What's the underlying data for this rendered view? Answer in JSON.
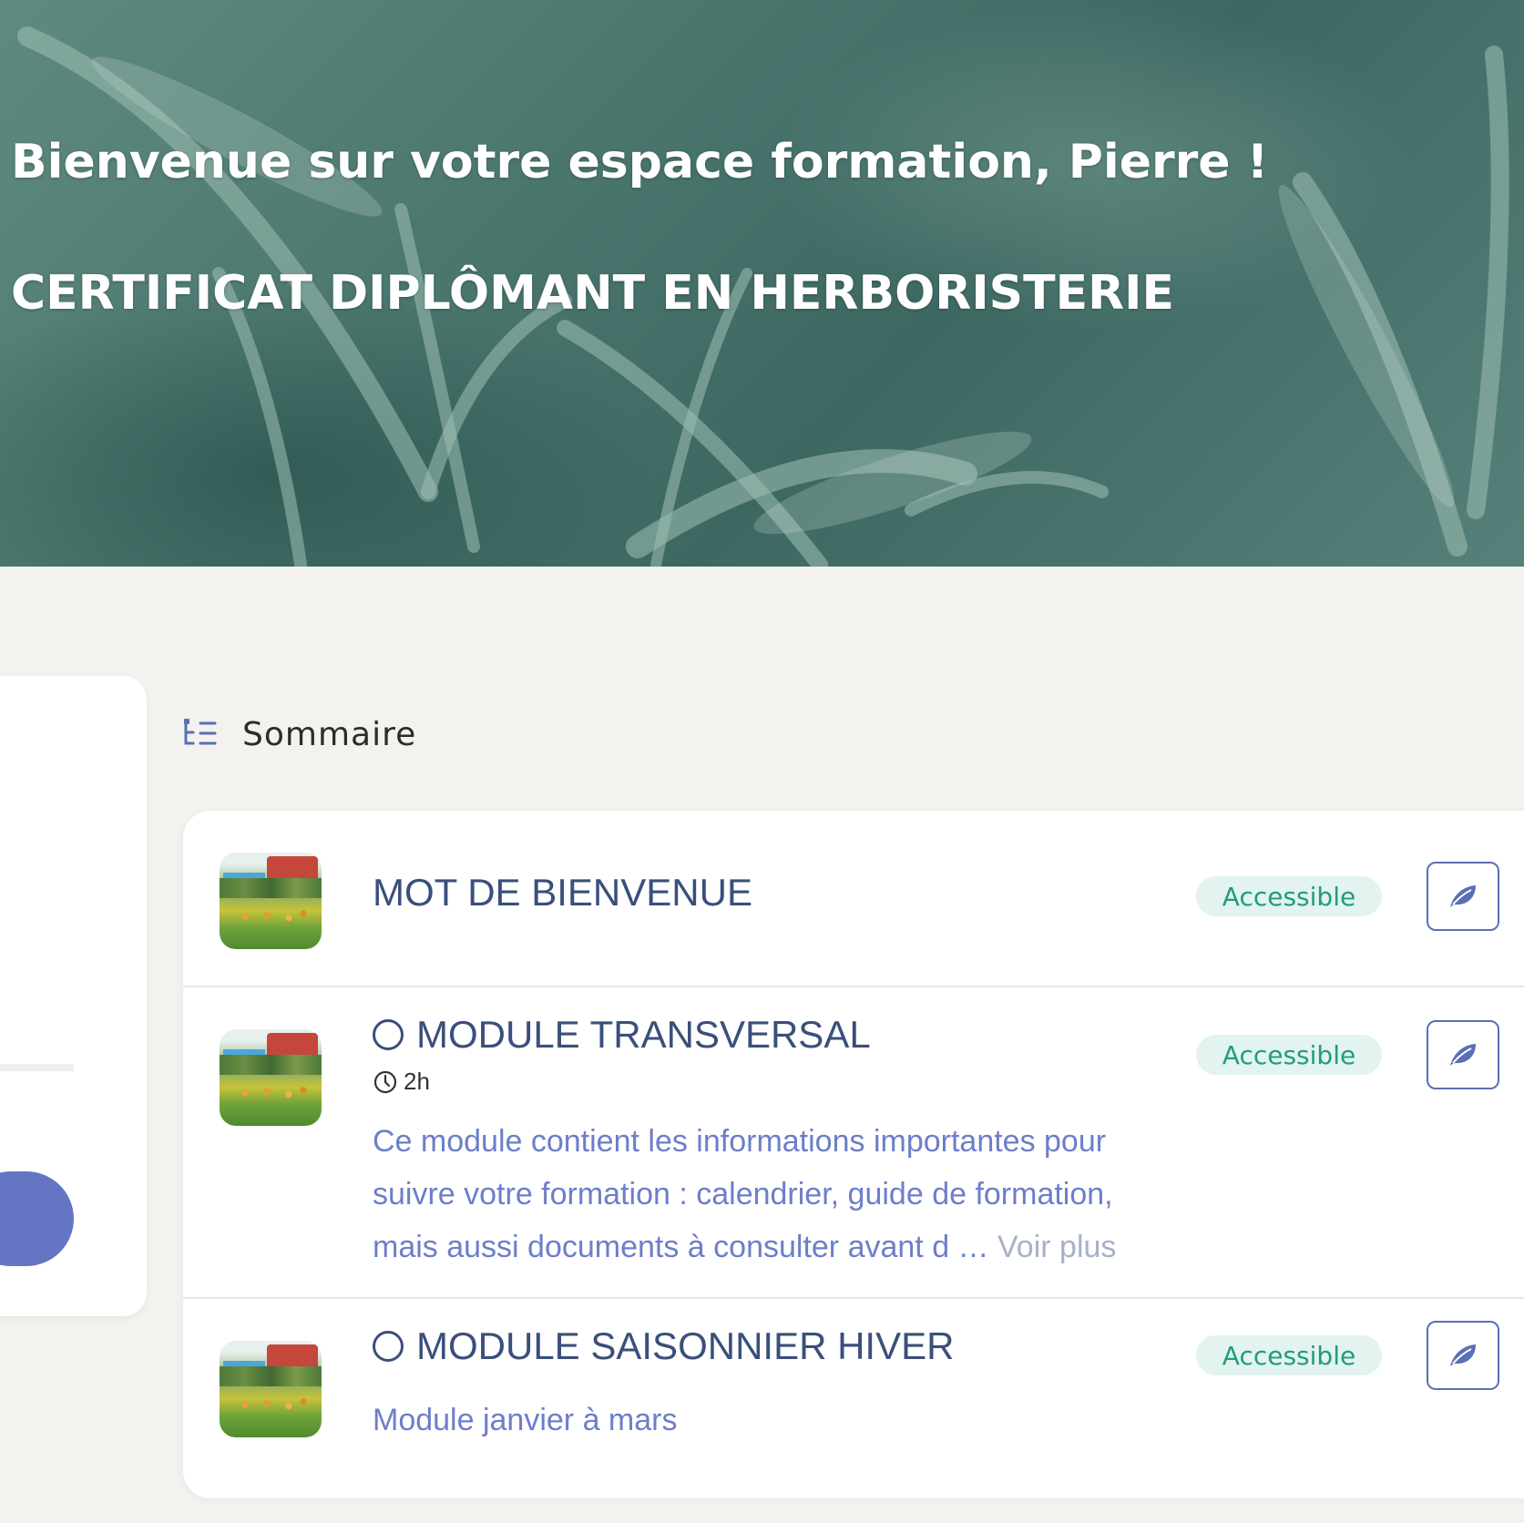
{
  "hero": {
    "title": "Bienvenue sur votre espace formation, Pierre !",
    "subtitle": "CERTIFICAT DIPLÔMANT EN HERBORISTERIE"
  },
  "toc": {
    "label": "Sommaire",
    "icon": "list-tree-icon"
  },
  "modules": [
    {
      "title": "MOT DE BIENVENUE",
      "status": "Accessible",
      "has_progress_circle": false
    },
    {
      "title": "MODULE TRANSVERSAL",
      "status": "Accessible",
      "has_progress_circle": true,
      "duration": "2h",
      "description": "Ce module contient les informations importantes pour suivre votre formation : calendrier, guide de formation, mais aussi documents à consulter avant d …",
      "more_label": "Voir plus"
    },
    {
      "title": "MODULE SAISONNIER HIVER",
      "status": "Accessible",
      "has_progress_circle": true,
      "description": "Module janvier à mars"
    }
  ],
  "colors": {
    "accent": "#6475c3",
    "title": "#3a4f7a",
    "description": "#6d7ec9",
    "badge_bg": "#e3f3ef",
    "badge_text": "#1f9d7c",
    "page_bg": "#f3f2ee"
  },
  "icons": {
    "action": "leaf-icon",
    "duration": "clock-icon",
    "progress": "circle-outline-icon"
  }
}
